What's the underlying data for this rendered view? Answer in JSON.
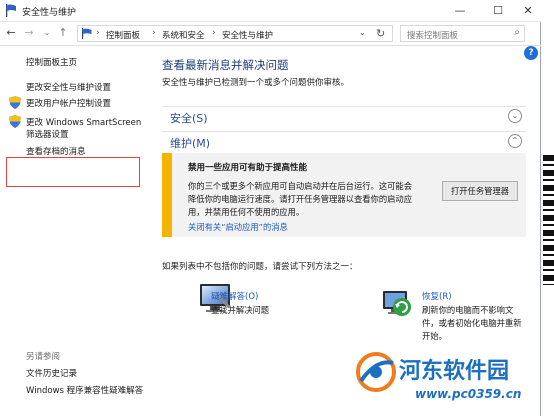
{
  "window": {
    "title": "安全性与维护"
  },
  "nav": {
    "breadcrumbs": [
      "控制面板",
      "系统和安全",
      "安全性与维护"
    ],
    "search_placeholder": "搜索控制面板",
    "help": "?"
  },
  "sidebar": {
    "home": "控制面板主页",
    "items": [
      "更改安全性与维护设置",
      "更改用户帐户控制设置",
      "更改 Windows SmartScreen",
      "筛选器设置",
      "查看存档的消息"
    ],
    "see_also_label": "另请参阅",
    "see_also": [
      "文件历史记录",
      "Windows 程序兼容性疑难解答"
    ]
  },
  "main": {
    "title": "查看最新消息并解决问题",
    "subtitle": "安全性与维护已检测到一个或多个问题供你审核。",
    "sections": [
      {
        "label": "安全(S)"
      },
      {
        "label": "维护(M)"
      }
    ],
    "notice": {
      "title": "禁用一些应用可有助于提高性能",
      "body": "你的三个或更多个新应用可自动启动并在后台运行。这可能会降低你的电脑运行速度。请打开任务管理器以查看你的启动应用，并禁用任何不使用的应用。",
      "link": "关闭有关“启动应用”的消息",
      "button": "打开任务管理器",
      "accent": "#f5b400"
    },
    "hint": "如果列表中不包括你的问题，请尝试下列方法之一：",
    "options": [
      {
        "title": "疑难解答(O)",
        "desc": "查找并解决问题",
        "icon": "troubleshoot-icon"
      },
      {
        "title": "恢复(R)",
        "desc": "刷新你的电脑而不影响文件，或者初始化电脑并重新开始。",
        "icon": "recovery-icon"
      }
    ]
  },
  "watermark": {
    "text": "河东软件园",
    "url": "www.pc0359.cn"
  }
}
